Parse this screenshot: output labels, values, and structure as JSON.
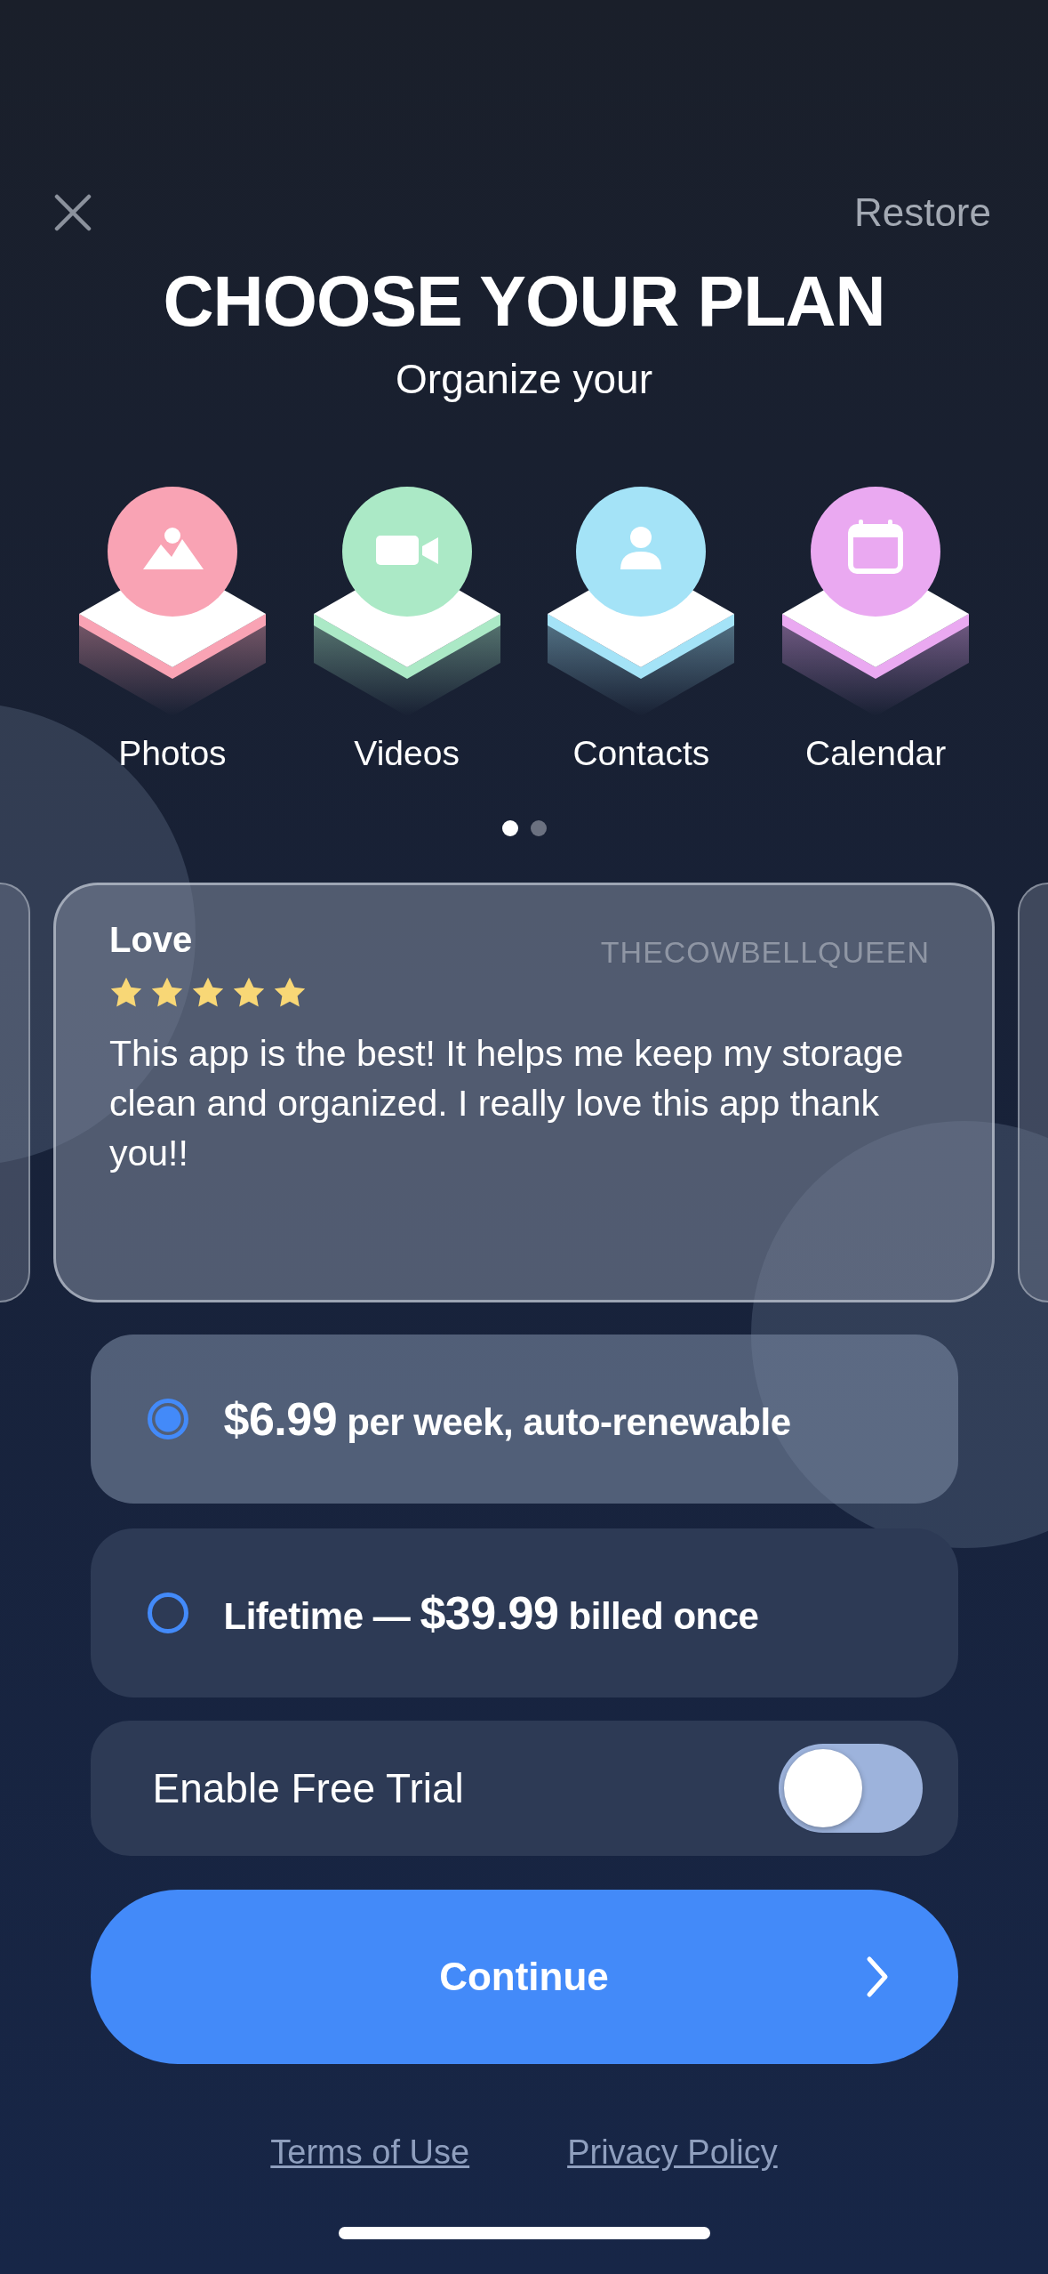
{
  "header": {
    "restore": "Restore"
  },
  "title": "CHOOSE YOUR PLAN",
  "subtitle": "Organize your",
  "categories": [
    {
      "label": "Photos",
      "kind": "photos",
      "color": "#f9a3b4"
    },
    {
      "label": "Videos",
      "kind": "videos",
      "color": "#abe9c6"
    },
    {
      "label": "Contacts",
      "kind": "contacts",
      "color": "#a4e3f7"
    },
    {
      "label": "Calendar",
      "kind": "calendar",
      "color": "#eaa9f1"
    }
  ],
  "pager": [
    {
      "selected": true
    },
    {
      "selected": false
    }
  ],
  "review": {
    "title": "Love",
    "author": "THECOWBELLQUEEN",
    "stars": 5,
    "text": "This app is the best! It helps me keep my storage clean and organized. I really love this app thank you!!"
  },
  "plans": [
    {
      "price": "$6.99",
      "after": " per week, auto-renewable",
      "selected": true
    },
    {
      "before": "Lifetime — ",
      "price": "$39.99",
      "after": " billed once",
      "selected": false
    }
  ],
  "free_trial": {
    "label": "Enable Free Trial",
    "on": false
  },
  "continue_button": "Continue",
  "links": [
    "Terms of Use",
    "Privacy Policy"
  ]
}
